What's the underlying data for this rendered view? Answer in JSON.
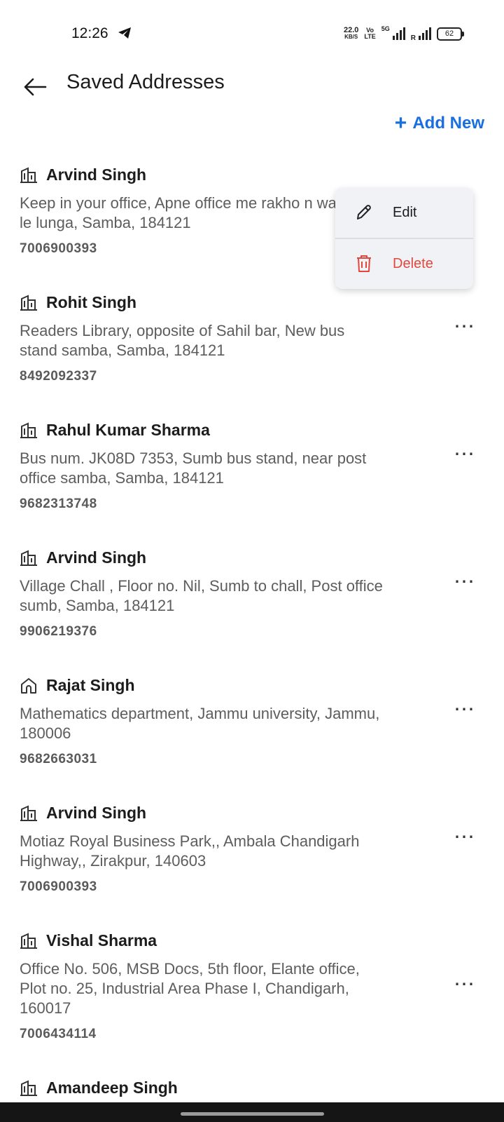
{
  "status_bar": {
    "time": "12:26",
    "net_speed_value": "22.0",
    "net_speed_unit": "KB/S",
    "volte_top": "Vo",
    "volte_bottom": "LTE",
    "network_5g": "5G",
    "roaming": "R",
    "battery": "62"
  },
  "header": {
    "title": "Saved Addresses",
    "add_new_label": "Add New"
  },
  "addresses": [
    {
      "type_icon": "office-building-icon",
      "name": "Arvind Singh",
      "address": "Keep in your office, Apne office me rakho n waha se le lunga, Samba, 184121",
      "phone": "7006900393"
    },
    {
      "type_icon": "office-building-icon",
      "name": "Rohit Singh",
      "address": "Readers Library, opposite of Sahil bar, New bus stand samba, Samba, 184121",
      "phone": "8492092337"
    },
    {
      "type_icon": "office-building-icon",
      "name": "Rahul Kumar Sharma",
      "address": "Bus num. JK08D 7353, Sumb bus stand, near post office samba, Samba, 184121",
      "phone": "9682313748"
    },
    {
      "type_icon": "office-building-icon",
      "name": "Arvind Singh",
      "address": "Village Chall , Floor no. Nil, Sumb to chall, Post office sumb, Samba, 184121",
      "phone": "9906219376"
    },
    {
      "type_icon": "home-icon",
      "name": "Rajat Singh",
      "address": "Mathematics department, Jammu university, Jammu, 180006",
      "phone": "9682663031"
    },
    {
      "type_icon": "office-building-icon",
      "name": "Arvind Singh",
      "address": "Motiaz Royal Business Park,, Ambala Chandigarh Highway,, Zirakpur, 140603",
      "phone": "7006900393"
    },
    {
      "type_icon": "office-building-icon",
      "name": "Vishal Sharma",
      "address": "Office No. 506, MSB Docs, 5th floor, Elante office, Plot no. 25, Industrial Area Phase I, Chandigarh, 160017",
      "phone": "7006434114"
    },
    {
      "type_icon": "office-building-icon",
      "name": "Amandeep Singh",
      "address": "",
      "phone": ""
    }
  ],
  "context_menu": {
    "edit_label": "Edit",
    "delete_label": "Delete"
  },
  "colors": {
    "accent": "#1a6fe0",
    "delete": "#e0483c"
  }
}
